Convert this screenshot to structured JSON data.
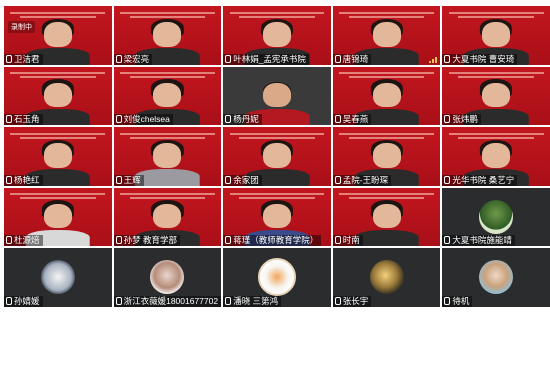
{
  "meeting": {
    "recording_label": "录制中"
  },
  "tiles": [
    {
      "name": "卫洁君",
      "style": "red"
    },
    {
      "name": "梁宏亮",
      "style": "red"
    },
    {
      "name": "叶林娟_孟宪承书院",
      "style": "red"
    },
    {
      "name": "唐锦琦",
      "style": "red"
    },
    {
      "name": "大夏书院 曹安琦",
      "style": "red"
    },
    {
      "name": "石玉角",
      "style": "red"
    },
    {
      "name": "刘俊chelsea",
      "style": "red"
    },
    {
      "name": "杨丹妮",
      "style": "gray"
    },
    {
      "name": "吴春燕",
      "style": "red"
    },
    {
      "name": "张炜鹏",
      "style": "red"
    },
    {
      "name": "杨艳红",
      "style": "red"
    },
    {
      "name": "王辉",
      "style": "red"
    },
    {
      "name": "余家团",
      "style": "red"
    },
    {
      "name": "孟院-王盼琛",
      "style": "red"
    },
    {
      "name": "光华书院 桑艺宁",
      "style": "red"
    },
    {
      "name": "杜源焙",
      "style": "red"
    },
    {
      "name": "孙梦 教育学部",
      "style": "red"
    },
    {
      "name": "蒋瑾（教师教育学院）",
      "style": "red"
    },
    {
      "name": "时南",
      "style": "red"
    },
    {
      "name": "大夏书院施能靖",
      "style": "dark"
    },
    {
      "name": "孙婧媛",
      "style": "dark"
    },
    {
      "name": "浙江衣薇媛18001677702",
      "style": "dark"
    },
    {
      "name": "潘晓 三第鸿",
      "style": "dark"
    },
    {
      "name": "张长宇",
      "style": "dark"
    },
    {
      "name": "待机",
      "style": "dark"
    }
  ],
  "colors": {
    "brand_red": "#b5121b",
    "dark_tile": "#2a2c2e",
    "label_bg": "rgba(0,0,0,.45)"
  }
}
